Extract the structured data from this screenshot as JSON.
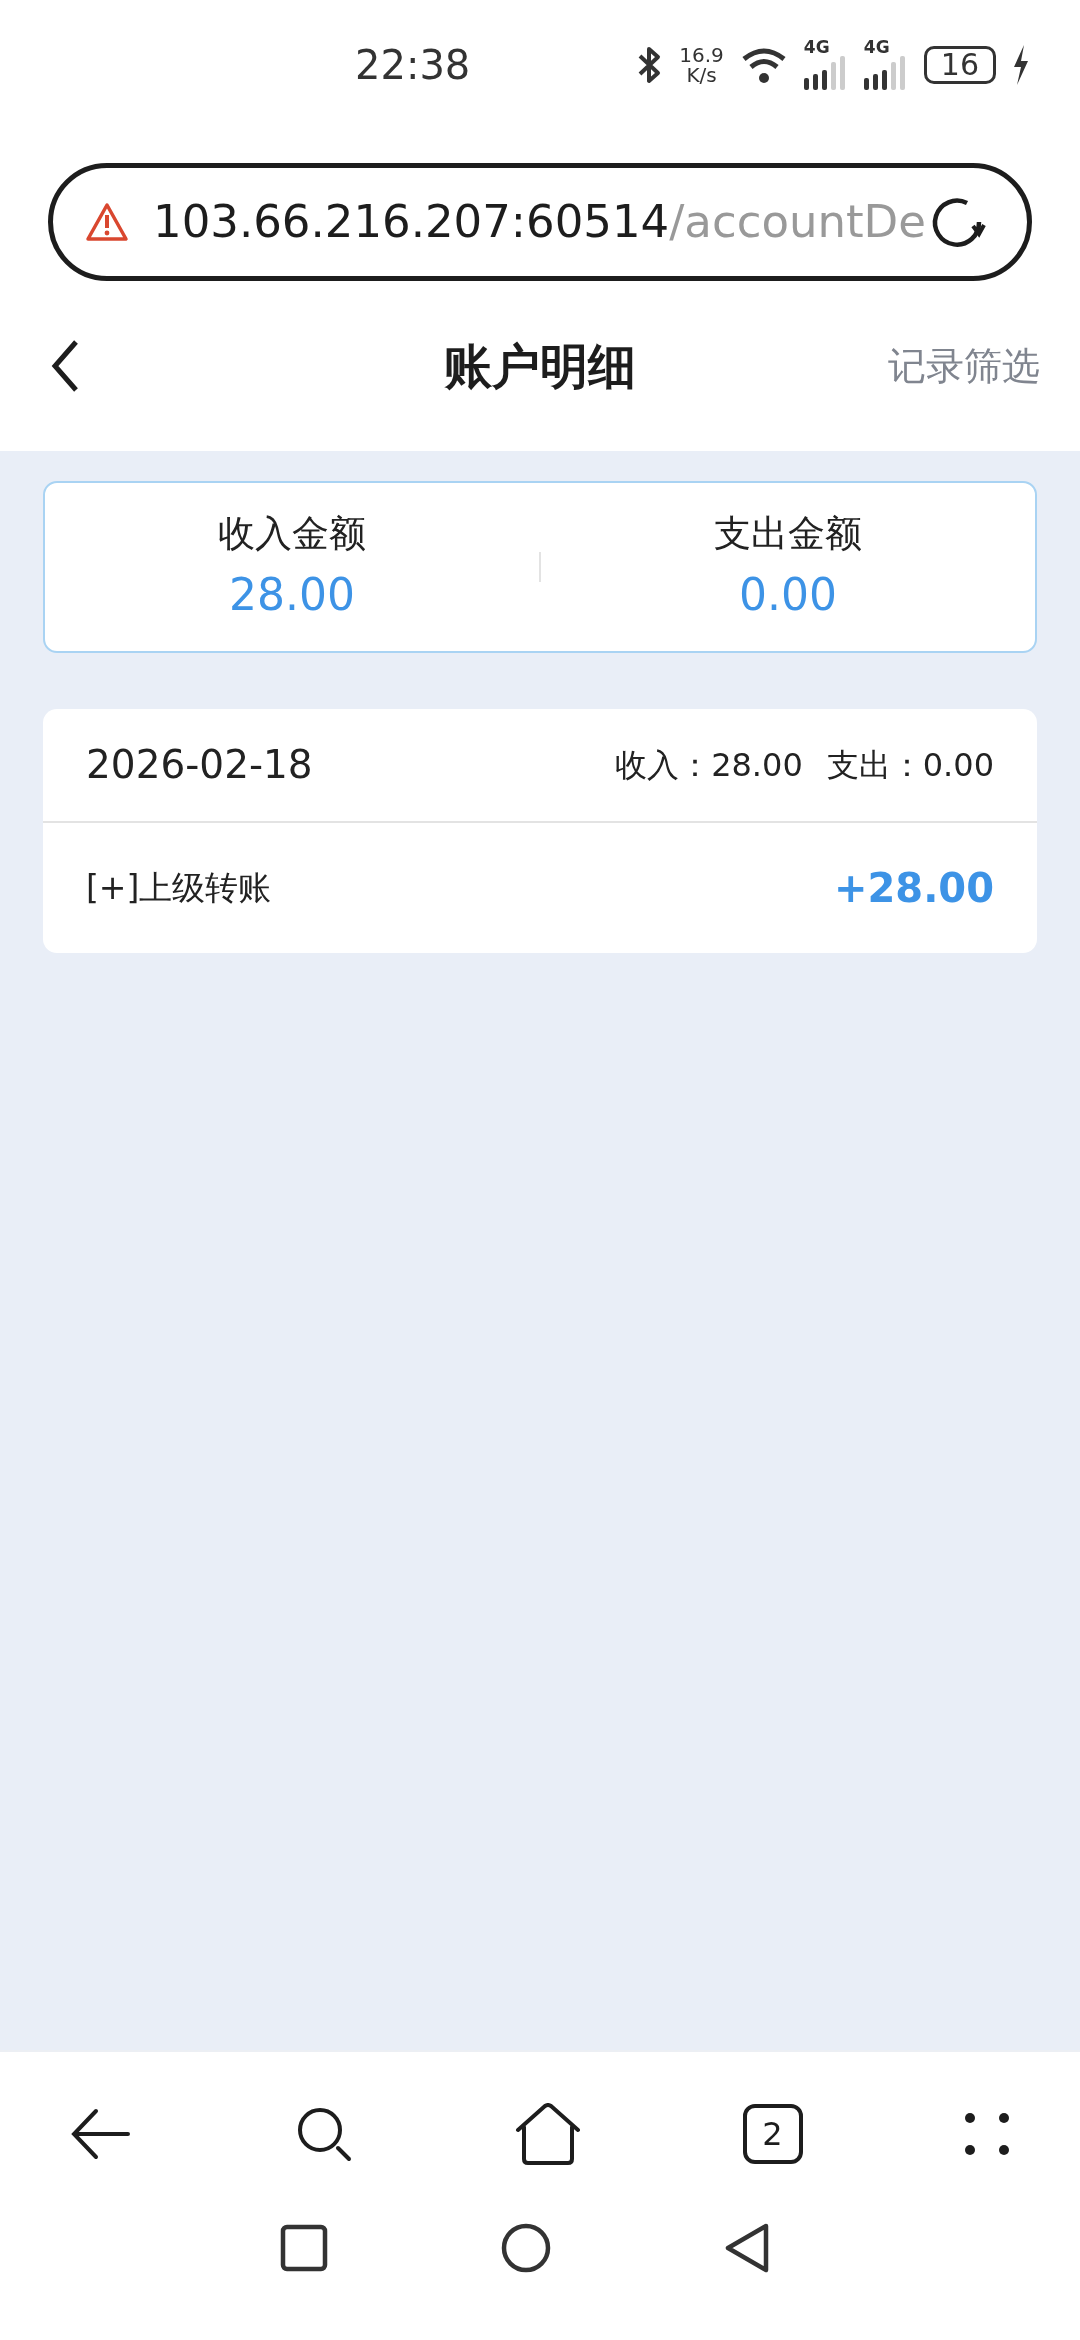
{
  "status_bar": {
    "time": "22:38",
    "net_speed_value": "16.9",
    "net_speed_unit": "K/s",
    "signal_1": "4G",
    "signal_2": "4G",
    "battery": "16"
  },
  "address_bar": {
    "host": "103.66.216.207:60514",
    "path": "/accountDe"
  },
  "header": {
    "title": "账户明细",
    "action": "记录筛选"
  },
  "summary": [
    {
      "label": "收入金额",
      "value": "28.00"
    },
    {
      "label": "支出金额",
      "value": "0.00"
    }
  ],
  "days": [
    {
      "date": "2026-02-18",
      "income_label": "收入：",
      "income": "28.00",
      "expense_label": "支出：",
      "expense": "0.00",
      "entries": [
        {
          "title": "[+]上级转账",
          "amount": "+28.00"
        }
      ]
    }
  ],
  "browser_bar": {
    "tab_count": "2"
  }
}
